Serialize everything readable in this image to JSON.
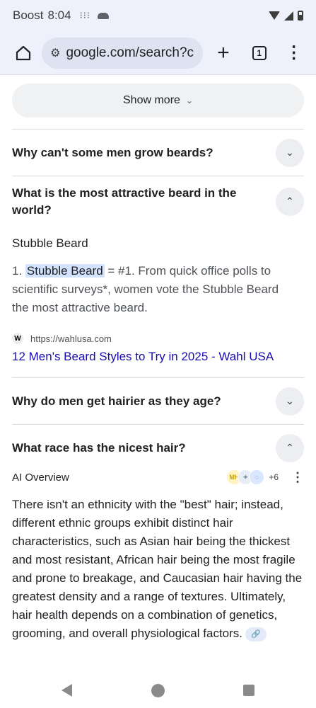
{
  "status_bar": {
    "carrier": "Boost",
    "time": "8:04",
    "dots": "⁝⁝⁝"
  },
  "toolbar": {
    "url": "google.com/search?client=ms-android-boost-us",
    "tab_count": "1"
  },
  "show_more": {
    "label": "Show more"
  },
  "faqs": [
    {
      "question": "Why can't some men grow beards?",
      "expanded": false
    },
    {
      "question": "What is the most attractive beard in the world?",
      "expanded": true
    },
    {
      "question": "Why do men get hairier as they age?",
      "expanded": false
    },
    {
      "question": "What race has the nicest hair?",
      "expanded": true
    }
  ],
  "answer": {
    "title": "Stubble Beard",
    "prefix": "1. ",
    "highlight": "Stubble Beard",
    "rest": " = #1. From quick office polls to scientific surveys*, women vote the Stubble Beard the most attractive beard.",
    "source_favicon": "W",
    "source_url": "https://wahlusa.com",
    "source_link": "12 Men's Beard Styles to Try in 2025 - Wahl USA"
  },
  "ai_overview": {
    "label": "AI Overview",
    "more_sources": "+6",
    "text": "There isn't an ethnicity with the \"best\" hair; instead, different ethnic groups exhibit distinct hair characteristics, such as Asian hair being the thickest and most resistant, African hair being the most fragile and prone to breakage, and Caucasian hair having the greatest density and a range of textures. Ultimately, hair health depends on a combination of genetics, grooming, and overall physiological factors."
  }
}
